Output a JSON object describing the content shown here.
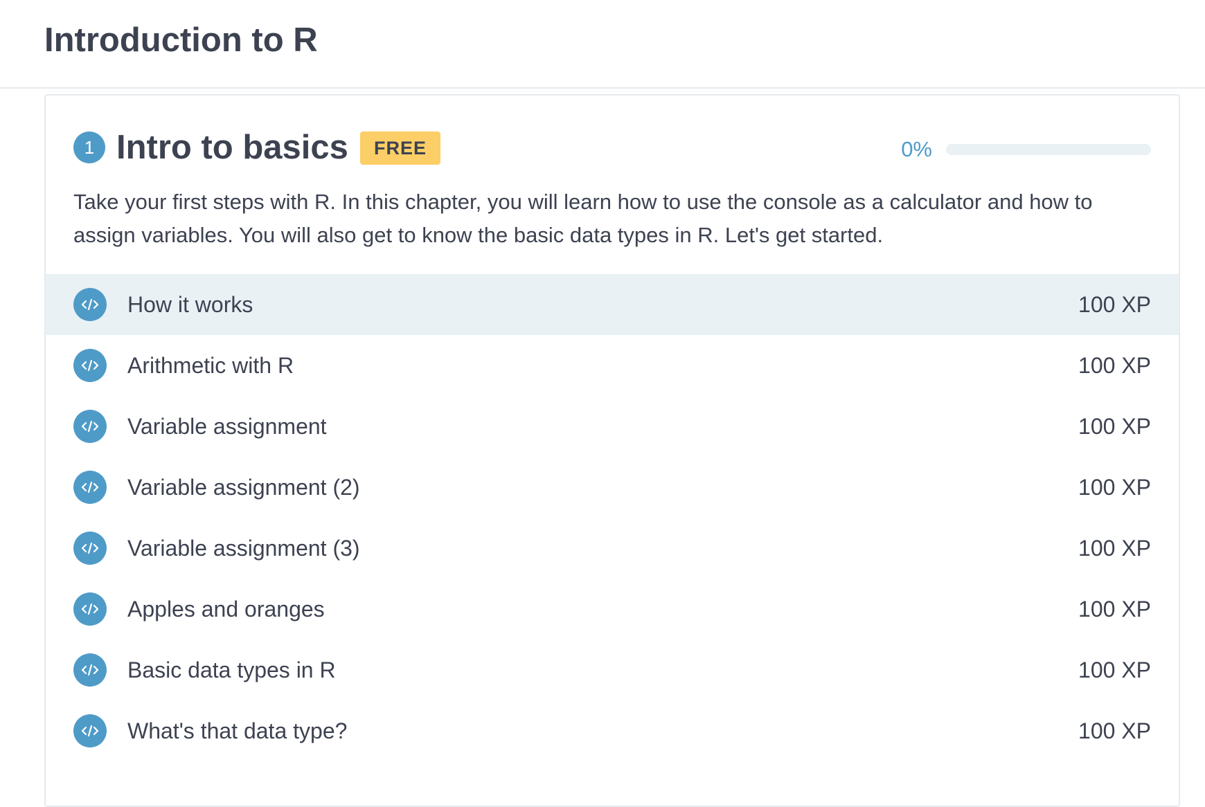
{
  "course": {
    "title": "Introduction to R"
  },
  "chapter": {
    "number": "1",
    "title": "Intro to basics",
    "badge": "FREE",
    "progress_label": "0%",
    "progress_fraction": 0,
    "description": "Take your first steps with R. In this chapter, you will learn how to use the console as a calculator and how to assign variables. You will also get to know the basic data types in R. Let's get started.",
    "exercises": [
      {
        "title": "How it works",
        "xp": "100 XP",
        "icon": "code-icon"
      },
      {
        "title": "Arithmetic with R",
        "xp": "100 XP",
        "icon": "code-icon"
      },
      {
        "title": "Variable assignment",
        "xp": "100 XP",
        "icon": "code-icon"
      },
      {
        "title": "Variable assignment (2)",
        "xp": "100 XP",
        "icon": "code-icon"
      },
      {
        "title": "Variable assignment (3)",
        "xp": "100 XP",
        "icon": "code-icon"
      },
      {
        "title": "Apples and oranges",
        "xp": "100 XP",
        "icon": "code-icon"
      },
      {
        "title": "Basic data types in R",
        "xp": "100 XP",
        "icon": "code-icon"
      },
      {
        "title": "What's that data type?",
        "xp": "100 XP",
        "icon": "code-icon"
      }
    ]
  },
  "colors": {
    "accent": "#4f9bc8",
    "badge": "#fcce67",
    "highlight_row": "#e9f1f5",
    "text": "#3d4251"
  }
}
